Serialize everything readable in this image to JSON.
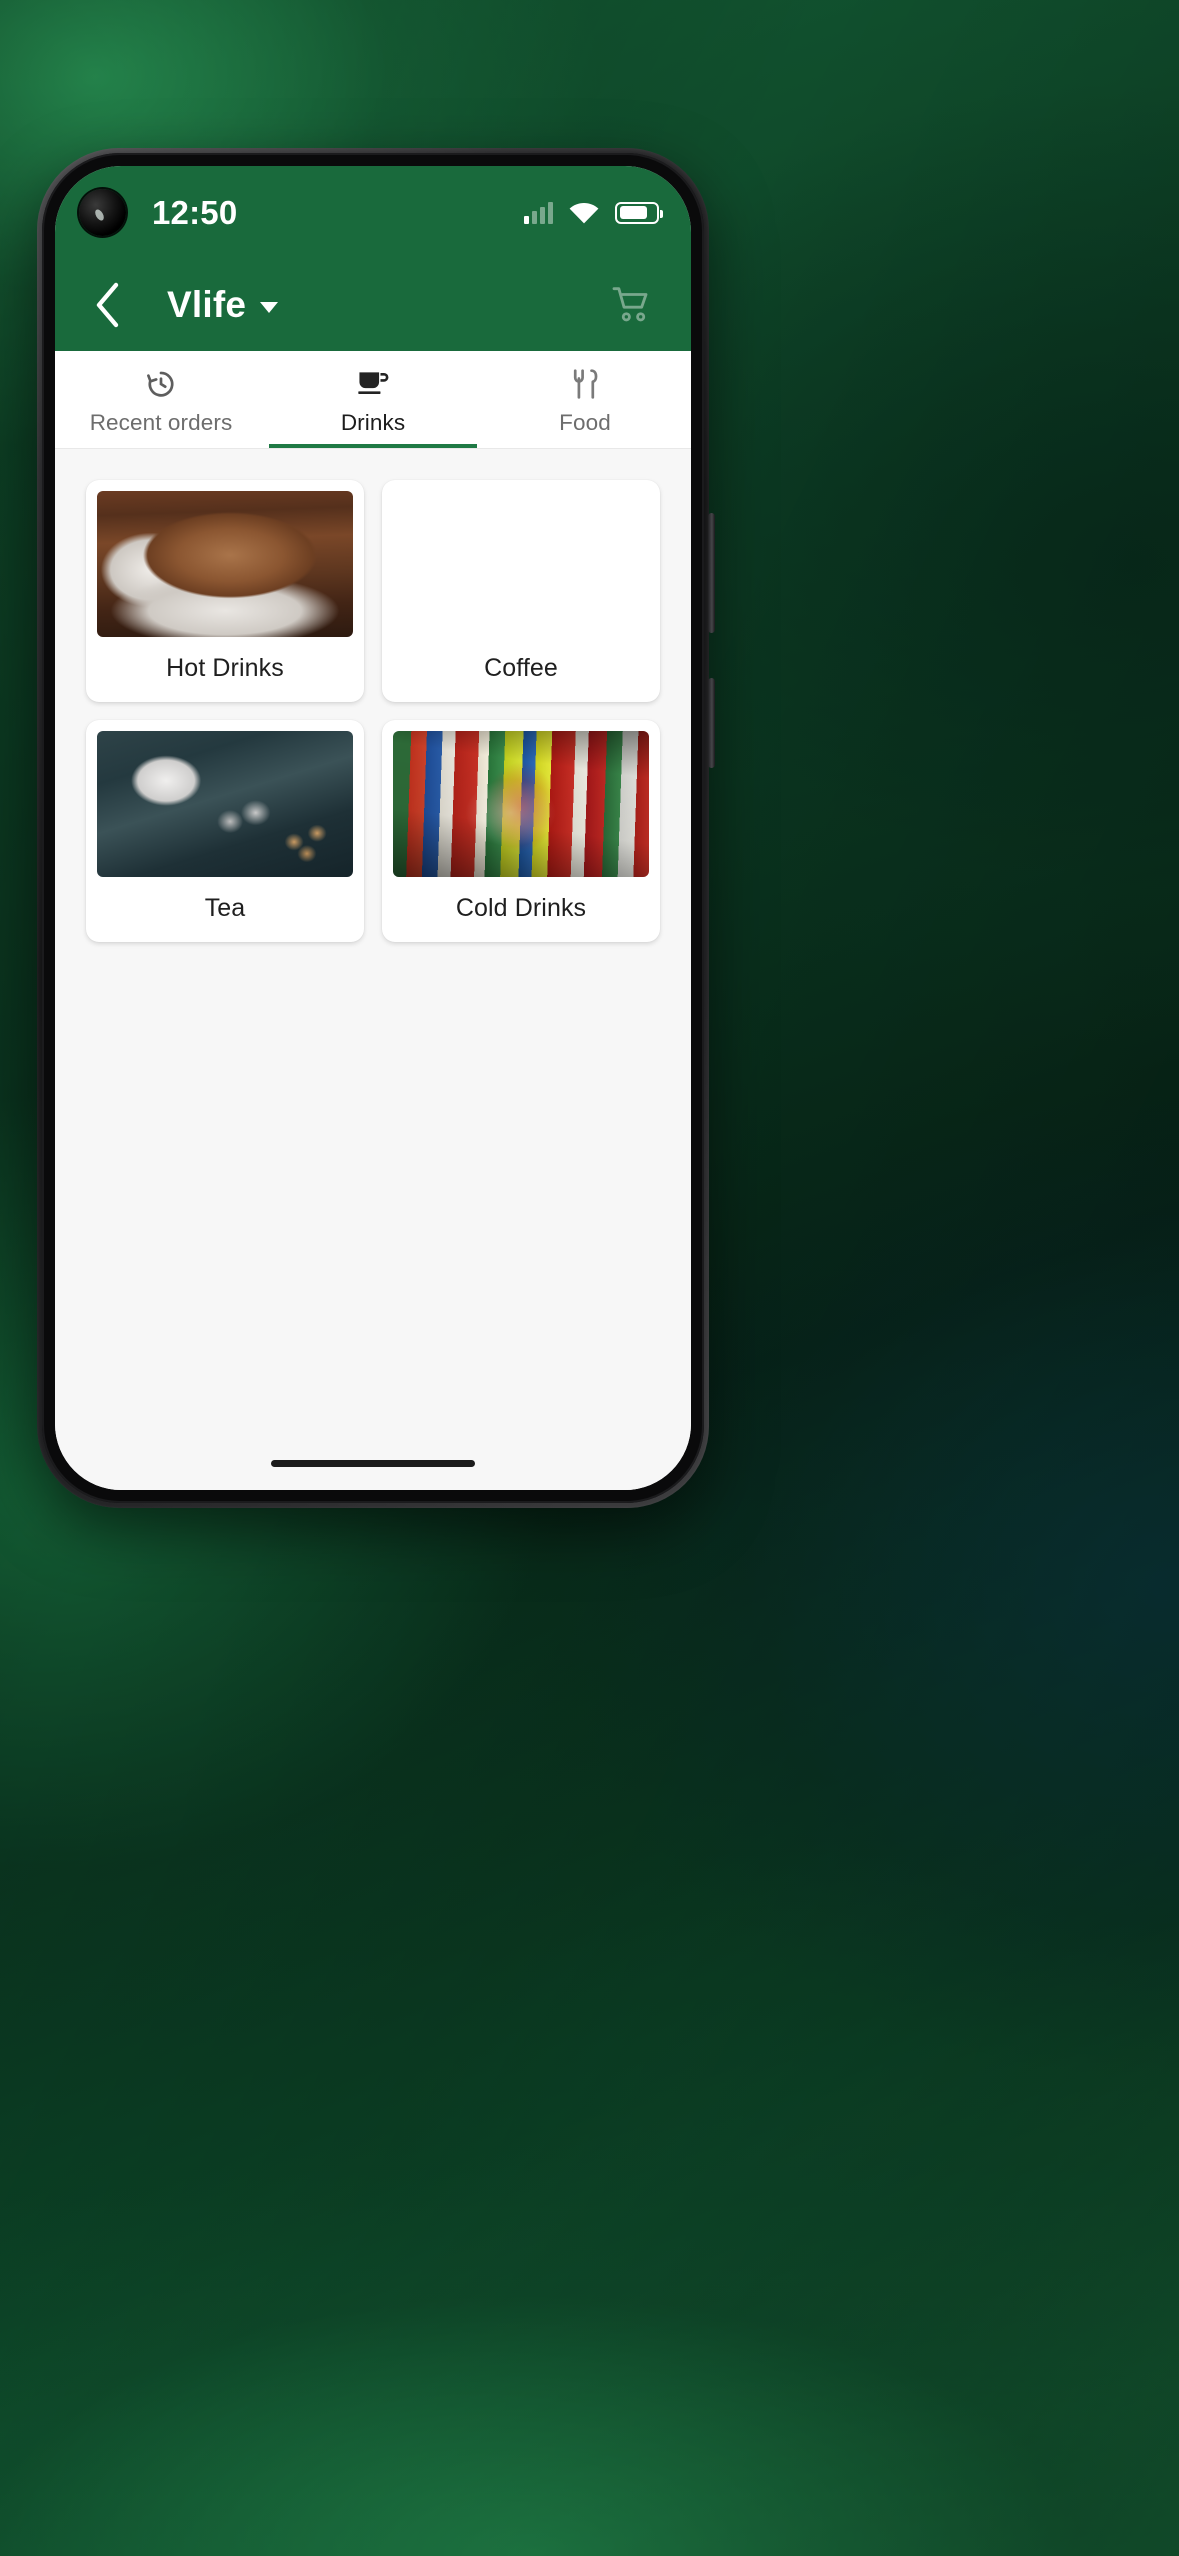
{
  "theme": {
    "brand_green": "#196A3C",
    "accent_underline": "#1F7A45",
    "content_bg": "#F7F7F7",
    "card_bg": "#FFFFFF",
    "active_tab_text": "#1D1D1D",
    "inactive_tab_text": "#6D6D6D"
  },
  "status_bar": {
    "time": "12:50",
    "signal_icon": "signal-bars-icon",
    "wifi_icon": "wifi-icon",
    "battery_icon": "battery-icon",
    "camera_icon": "front-camera-punchhole"
  },
  "app_bar": {
    "back_icon": "chevron-left-icon",
    "title": "Vlife",
    "dropdown_icon": "caret-down-icon",
    "cart_icon": "shopping-cart-icon"
  },
  "tabs": [
    {
      "label": "Recent orders",
      "icon": "history-icon",
      "active": false
    },
    {
      "label": "Drinks",
      "icon": "coffee-cup-icon",
      "active": true
    },
    {
      "label": "Food",
      "icon": "fork-knife-icon",
      "active": false
    }
  ],
  "categories": [
    {
      "label": "Hot Drinks",
      "image": "latte-in-white-cup-on-wood-photo"
    },
    {
      "label": "Coffee",
      "image": "cappuccino-latte-art-with-cinnamon-photo"
    },
    {
      "label": "Tea",
      "image": "tea-cup-with-spoons-and-sugar-cubes-photo"
    },
    {
      "label": "Cold Drinks",
      "image": "assorted-soda-bottles-coca-cola-photo"
    }
  ],
  "system": {
    "home_indicator": "home-gesture-bar"
  }
}
